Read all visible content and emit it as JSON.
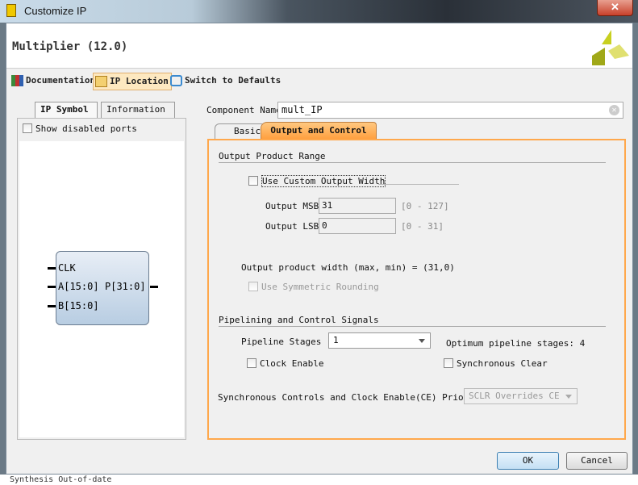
{
  "window": {
    "title": "Customize IP",
    "close_label": "✕"
  },
  "header": {
    "ip_title": "Multiplier (12.0)"
  },
  "toolbar": {
    "documentation": "Documentation",
    "ip_location": "IP Location",
    "switch_defaults": "Switch to Defaults"
  },
  "left": {
    "tabs": [
      "IP Symbol",
      "Information"
    ],
    "show_disabled": "Show disabled ports",
    "ports": {
      "clk": "CLK",
      "a": "A[15:0]",
      "b": "B[15:0]",
      "p": "P[31:0]"
    }
  },
  "component": {
    "label": "Component Name",
    "value": "mult_IP"
  },
  "tabs": [
    "Basic",
    "Output and Control"
  ],
  "output_range": {
    "heading": "Output Product Range",
    "custom_width": "Use Custom Output Width",
    "msb_label": "Output MSB",
    "msb_value": "31",
    "msb_range": "[0 - 127]",
    "lsb_label": "Output LSB",
    "lsb_value": "0",
    "lsb_range": "[0 - 31]",
    "width_text": "Output product width (max, min) = (31,0)",
    "symmetric": "Use Symmetric Rounding"
  },
  "pipelining": {
    "heading": "Pipelining and Control Signals",
    "stages_label": "Pipeline Stages",
    "stages_value": "1",
    "optimum": "Optimum pipeline stages: 4",
    "clock_enable": "Clock Enable",
    "sync_clear": "Synchronous Clear",
    "priority_label": "Synchronous Controls and Clock Enable(CE) Priority",
    "priority_value": "SCLR Overrides CE"
  },
  "buttons": {
    "ok": "OK",
    "cancel": "Cancel"
  },
  "background": {
    "status": "Synthesis Out-of-date"
  }
}
